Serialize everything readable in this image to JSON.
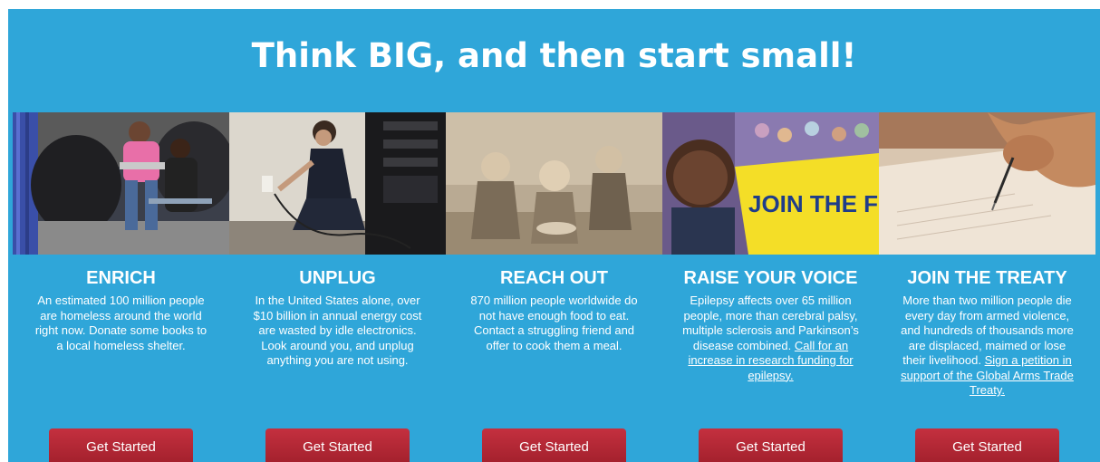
{
  "headline": "Think BIG, and then start small!",
  "colors": {
    "panel_bg": "#2fa6d9",
    "button_bg": "#b52634",
    "text": "#ffffff"
  },
  "cards": [
    {
      "title": "ENRICH",
      "body": "An estimated 100 million people are homeless around the world right now. Donate some books to a local homeless shelter.",
      "link": "",
      "button": "Get Started",
      "image": "children-reading-photo"
    },
    {
      "title": "UNPLUG",
      "body": "In the United States alone, over $10 billion in annual energy cost are wasted by idle electronics. Look around you, and unplug anything you are not using.",
      "link": "",
      "button": "Get Started",
      "image": "woman-unplugging-photo"
    },
    {
      "title": "REACH OUT",
      "body": "870 million people worldwide do not have enough food to eat. Contact a struggling friend and offer to cook them a meal.",
      "link": "",
      "button": "Get Started",
      "image": "hungry-children-photo"
    },
    {
      "title": "RAISE YOUR VOICE",
      "body": "Epilepsy affects over 65 million people, more than cerebral palsy, multiple sclerosis and Parkinson’s disease combined.",
      "link": "Call for an increase in research funding for epilepsy.",
      "button": "Get Started",
      "image": "join-the-fight-photo",
      "sign_text": "JOIN THE FIGHT"
    },
    {
      "title": "JOIN THE TREATY",
      "body": "More than two million people die every day from armed violence, and hundreds of thousands more are displaced, maimed or lose their livelihood.",
      "link": "Sign a petition in support of the Global Arms Trade Treaty.",
      "button": "Get Started",
      "image": "hand-writing-photo"
    }
  ]
}
